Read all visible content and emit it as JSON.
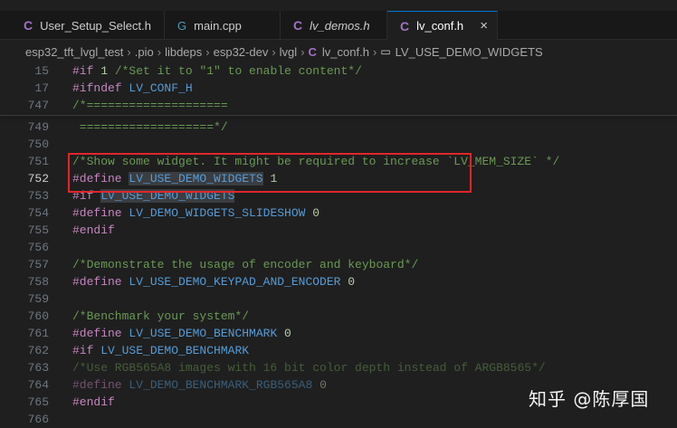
{
  "tabs": [
    {
      "label": "User_Setup_Select.h",
      "icon": "c-header-icon",
      "italic": false
    },
    {
      "label": "main.cpp",
      "icon": "cpp-icon",
      "italic": false
    },
    {
      "label": "lv_demos.h",
      "icon": "c-header-icon",
      "italic": true
    },
    {
      "label": "lv_conf.h",
      "icon": "c-header-icon",
      "italic": false,
      "active": true,
      "close": "×"
    }
  ],
  "breadcrumb": [
    "esp32_tft_lvgl_test",
    ".pio",
    "libdeps",
    "esp32-dev",
    "lvgl",
    "lv_conf.h",
    "LV_USE_DEMO_WIDGETS"
  ],
  "icons": {
    "c": "C",
    "cpp": "G",
    "symbol": "▭",
    "sep": "›"
  },
  "sticky": [
    {
      "n": "15",
      "parts": [
        [
          "kw",
          "#if "
        ],
        [
          "num",
          "1"
        ],
        [
          "cm",
          " /*Set it to \"1\" to enable content*/"
        ]
      ]
    },
    {
      "n": "17",
      "parts": [
        [
          "kw",
          "#ifndef "
        ],
        [
          "mc",
          "LV_CONF_H"
        ]
      ]
    },
    {
      "n": "747",
      "parts": [
        [
          "cm",
          "/*===================="
        ]
      ]
    }
  ],
  "lines": [
    {
      "n": "749",
      "parts": [
        [
          "cm",
          " ===================*/"
        ]
      ]
    },
    {
      "n": "750",
      "parts": []
    },
    {
      "n": "751",
      "parts": [
        [
          "cm",
          "/*Show some widget. It might be required to increase `LV_MEM_SIZE` */"
        ]
      ]
    },
    {
      "n": "752",
      "parts": [
        [
          "kw",
          "#define "
        ],
        [
          "mc",
          "LV_USE_DEMO_WIDGETS",
          "hl"
        ],
        [
          "num",
          " 1"
        ]
      ],
      "current": true
    },
    {
      "n": "753",
      "parts": [
        [
          "kw",
          "#if "
        ],
        [
          "mc",
          "LV_USE_DEMO_WIDGETS",
          "hl"
        ]
      ]
    },
    {
      "n": "754",
      "parts": [
        [
          "kw",
          "#define "
        ],
        [
          "mc",
          "LV_DEMO_WIDGETS_SLIDESHOW"
        ],
        [
          "num",
          " 0"
        ]
      ]
    },
    {
      "n": "755",
      "parts": [
        [
          "kw",
          "#endif"
        ]
      ]
    },
    {
      "n": "756",
      "parts": []
    },
    {
      "n": "757",
      "parts": [
        [
          "cm",
          "/*Demonstrate the usage of encoder and keyboard*/"
        ]
      ]
    },
    {
      "n": "758",
      "parts": [
        [
          "kw",
          "#define "
        ],
        [
          "mc",
          "LV_USE_DEMO_KEYPAD_AND_ENCODER"
        ],
        [
          "num",
          " 0"
        ]
      ]
    },
    {
      "n": "759",
      "parts": []
    },
    {
      "n": "760",
      "parts": [
        [
          "cm",
          "/*Benchmark your system*/"
        ]
      ]
    },
    {
      "n": "761",
      "parts": [
        [
          "kw",
          "#define "
        ],
        [
          "mc",
          "LV_USE_DEMO_BENCHMARK"
        ],
        [
          "num",
          " 0"
        ]
      ]
    },
    {
      "n": "762",
      "parts": [
        [
          "kw",
          "#if "
        ],
        [
          "mc",
          "LV_USE_DEMO_BENCHMARK"
        ]
      ]
    },
    {
      "n": "763",
      "parts": [
        [
          "cm",
          "/*Use RGB565A8 images with 16 bit color depth instead of ARGB8565*/",
          "dim"
        ]
      ]
    },
    {
      "n": "764",
      "parts": [
        [
          "kw",
          "#define ",
          "dim"
        ],
        [
          "mc",
          "LV_DEMO_BENCHMARK_RGB565A8",
          "dim"
        ],
        [
          "num",
          " 0",
          "dim"
        ]
      ]
    },
    {
      "n": "765",
      "parts": [
        [
          "kw",
          "#endif"
        ]
      ]
    },
    {
      "n": "766",
      "parts": []
    }
  ],
  "watermark": "知乎 @陈厚国",
  "colors": {
    "accent": "#0078d4",
    "highlight_box": "#e0262b",
    "keyword": "#c586c0",
    "macro": "#569cd6",
    "comment": "#6a9955",
    "number": "#b5cea8"
  }
}
